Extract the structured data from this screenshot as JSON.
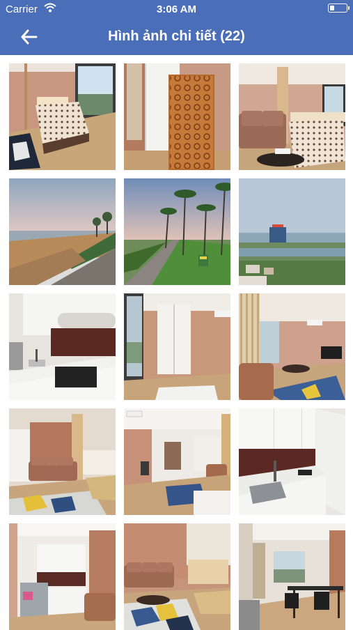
{
  "status_bar": {
    "carrier": "Carrier",
    "time": "3:06 AM"
  },
  "nav": {
    "title": "Hình ảnh chi tiết (22)",
    "back_icon": "back-arrow-icon"
  },
  "gallery": {
    "photos": [
      {
        "scene": "bedroom-window"
      },
      {
        "scene": "wardrobe-mattress"
      },
      {
        "scene": "bedroom-sofa"
      },
      {
        "scene": "beach-sunset"
      },
      {
        "scene": "palm-promenade"
      },
      {
        "scene": "city-bay-view"
      },
      {
        "scene": "kitchen-counter"
      },
      {
        "scene": "hallway-wardrobe"
      },
      {
        "scene": "living-room-tv"
      },
      {
        "scene": "living-room-sofa"
      },
      {
        "scene": "open-plan-living"
      },
      {
        "scene": "kitchen-sink"
      },
      {
        "scene": "kitchen-fridge"
      },
      {
        "scene": "living-room-rug"
      },
      {
        "scene": "dining-area"
      }
    ]
  },
  "colors": {
    "header": "#4a6fb8",
    "wood": "#c9a57a",
    "wall": "#c98f74"
  }
}
